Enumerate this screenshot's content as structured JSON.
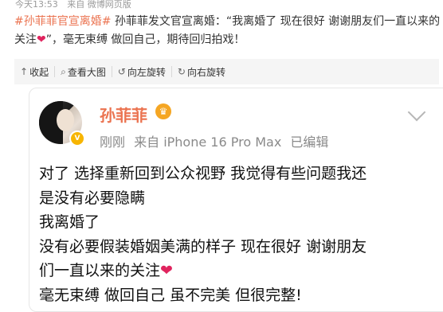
{
  "meta": {
    "time": "今天13:53",
    "source": "来自 微博网页版"
  },
  "headline": {
    "tag": "#孙菲菲官宣离婚#",
    "text1": " 孙菲菲发文官宣离婚：“我离婚了 现在很好 谢谢朋友们一直以来的关注",
    "heart": "❤",
    "text2": "”，毫无束缚 做回自己，期待回归拍戏！"
  },
  "actions": {
    "collapse": {
      "icon": "up-arrow-icon",
      "label": "收起"
    },
    "view_large": {
      "icon": "zoom-icon",
      "label": "查看大图"
    },
    "rotate_left": {
      "icon": "rotate-left-icon",
      "label": "向左旋转"
    },
    "rotate_right": {
      "icon": "rotate-right-icon",
      "label": "向右旋转"
    }
  },
  "card": {
    "username": "孙菲菲",
    "crown_icon": "crown-icon",
    "verified_icon": "verified-v-icon",
    "time": "刚刚",
    "source": "来自 iPhone 16 Pro Max",
    "edited": "已编辑",
    "lines": [
      "对了 选择重新回到公众视野 我觉得有些问题我还",
      "是没有必要隐瞒",
      "我离婚了",
      "没有必要假装婚姻美满的样子 现在很好 谢谢朋友",
      "们一直以来的关注",
      "毫无束缚 做回自己 虽不完美 但很完整!"
    ],
    "heart": "❤"
  },
  "colors": {
    "accent": "#eb7350",
    "heart": "#e0245e",
    "badge": "#f7b500"
  }
}
